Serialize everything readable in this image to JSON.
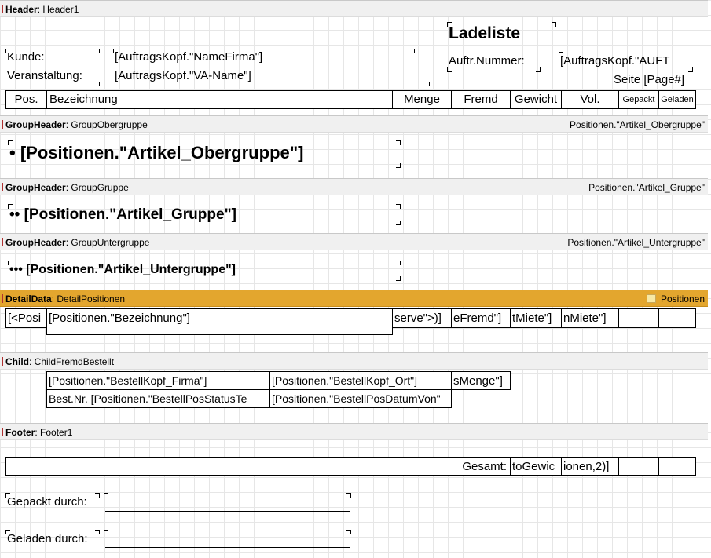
{
  "bands": {
    "header": {
      "kind": "Header",
      "name": "Header1"
    },
    "group_obergruppe": {
      "kind": "GroupHeader",
      "name": "GroupObergruppe",
      "condition": "Positionen.\"Artikel_Obergruppe\""
    },
    "group_gruppe": {
      "kind": "GroupHeader",
      "name": "GroupGruppe",
      "condition": "Positionen.\"Artikel_Gruppe\""
    },
    "group_untergruppe": {
      "kind": "GroupHeader",
      "name": "GroupUntergruppe",
      "condition": "Positionen.\"Artikel_Untergruppe\""
    },
    "detail": {
      "kind": "DetailData",
      "name": "DetailPositionen",
      "datasource": "Positionen"
    },
    "child": {
      "kind": "Child",
      "name": "ChildFremdBestellt"
    },
    "footer": {
      "kind": "Footer",
      "name": "Footer1"
    }
  },
  "header": {
    "title": "Ladeliste",
    "kunde_label": "Kunde:",
    "kunde_value": "[AuftragsKopf.\"NameFirma\"]",
    "veranstaltung_label": "Veranstaltung:",
    "veranstaltung_value": "[AuftragsKopf.\"VA-Name\"]",
    "auftr_label": "Auftr.Nummer:",
    "auftr_value": "[AuftragsKopf.\"AUFT",
    "page": "Seite [Page#]",
    "columns": {
      "pos": "Pos.",
      "bezeichnung": "Bezeichnung",
      "menge": "Menge",
      "fremd": "Fremd",
      "gewicht": "Gewicht",
      "vol": "Vol.",
      "gepackt": "Gepackt",
      "geladen": "Geladen"
    }
  },
  "groups": {
    "obergruppe": "• [Positionen.\"Artikel_Obergruppe\"]",
    "gruppe": "•• [Positionen.\"Artikel_Gruppe\"]",
    "untergruppe": "••• [Positionen.\"Artikel_Untergruppe\"]"
  },
  "detail": {
    "pos": "[<Posi",
    "bezeichnung": "[Positionen.\"Bezeichnung\"]",
    "menge": "serve\">)]",
    "fremd": "eFremd\"]",
    "gewicht": "tMiete\"]",
    "vol": "nMiete\"]"
  },
  "child": {
    "firma": "[Positionen.\"BestellKopf_Firma\"]",
    "ort": "[Positionen.\"BestellKopf_Ort\"]",
    "menge": "sMenge\"]",
    "bestnr": "Best.Nr.  [Positionen.\"BestellPosStatusTe",
    "datum": "[Positionen.\"BestellPosDatumVon\""
  },
  "footer": {
    "gesamt_label": "Gesamt:",
    "gewicht": "toGewic",
    "vol": "ionen,2)]",
    "gepackt_label": "Gepackt durch:",
    "geladen_label": "Geladen durch:"
  },
  "colors": {
    "band_bg": "#f0f0f0",
    "detail_band_bg": "#e3a62e",
    "band_marker": "#b03030"
  }
}
